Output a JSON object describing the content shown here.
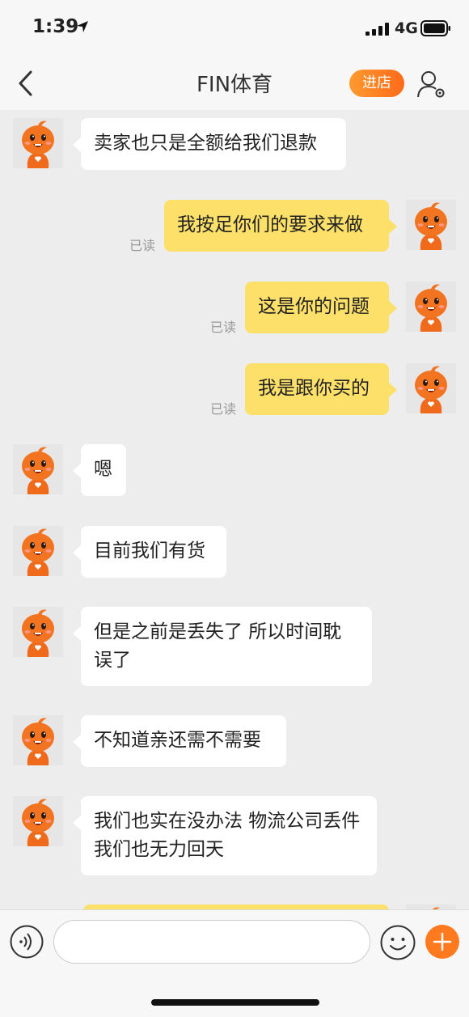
{
  "status_bar": {
    "time": "1:39",
    "network": "4G"
  },
  "nav": {
    "title": "FIN体育",
    "shop_label": "进店"
  },
  "messages": [
    {
      "side": "in",
      "text": "卖家也只是全额给我们退款"
    },
    {
      "side": "out",
      "text": "我按足你们的要求来做",
      "read": "已读"
    },
    {
      "side": "out",
      "text": "这是你的问题",
      "read": "已读"
    },
    {
      "side": "out",
      "text": "我是跟你买的",
      "read": "已读"
    },
    {
      "side": "in",
      "text": "嗯"
    },
    {
      "side": "in",
      "text": "目前我们有货"
    },
    {
      "side": "in",
      "text": "但是之前是丢失了 所以时间耽误了"
    },
    {
      "side": "in",
      "text": "不知道亲还需不需要"
    },
    {
      "side": "in",
      "text": "我们也实在没办法  物流公司丢件 我们也无力回天"
    },
    {
      "side": "out",
      "text": ""
    }
  ],
  "input": {
    "placeholder": ""
  },
  "icons": {
    "back": "chevron-left-icon",
    "profile": "user-settings-icon",
    "voice": "voice-icon",
    "emoji": "smiley-icon",
    "plus": "plus-icon"
  },
  "colors": {
    "accent": "#ff7a1f",
    "out_bubble": "#fce06a",
    "background": "#ededed"
  }
}
